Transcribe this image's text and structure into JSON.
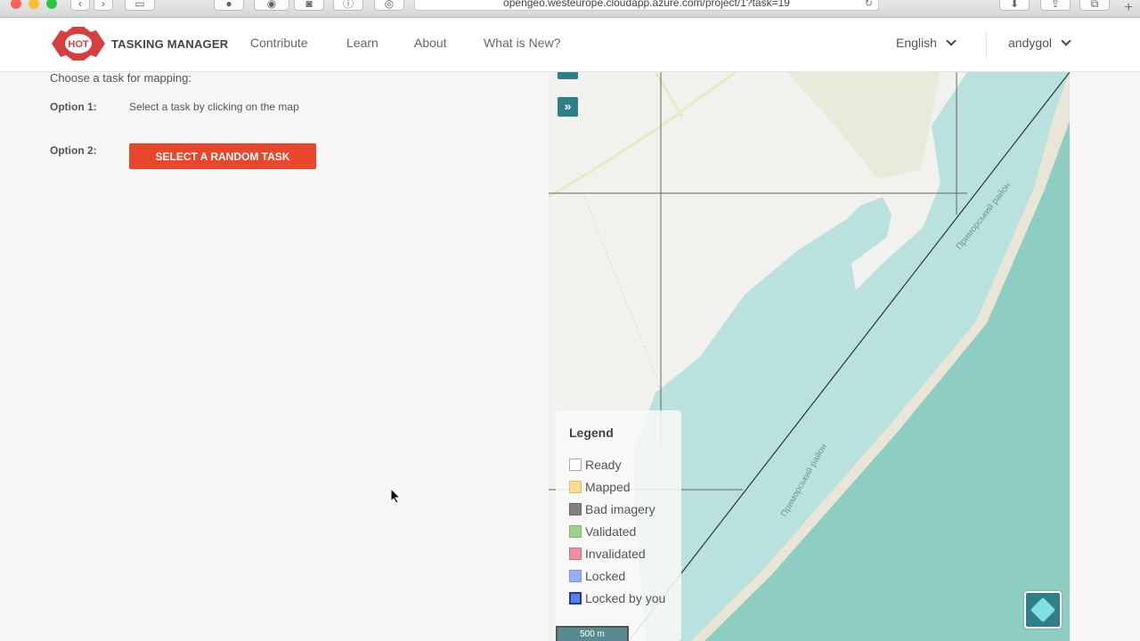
{
  "browser": {
    "url": "opengeo.westeurope.cloudapp.azure.com/project/1?task=19"
  },
  "header": {
    "logo_text": "HOT",
    "brand": "TASKING MANAGER",
    "nav": [
      {
        "label": "Contribute"
      },
      {
        "label": "Learn"
      },
      {
        "label": "About"
      },
      {
        "label": "What is New?"
      }
    ],
    "language": "English",
    "user": "andygol"
  },
  "panel": {
    "choose_text": "Choose a task for mapping:",
    "option1_label": "Option 1:",
    "option1_text": "Select a task by clicking on the map",
    "option2_label": "Option 2:",
    "random_button": "SELECT A RANDOM TASK"
  },
  "map": {
    "expand_icon": "»",
    "region_label_1": "Приморський район",
    "region_label_2": "Приморський район",
    "scale": "500 m",
    "legend": {
      "title": "Legend",
      "items": [
        {
          "label": "Ready",
          "color": "#ffffff"
        },
        {
          "label": "Mapped",
          "color": "#f9dc8f"
        },
        {
          "label": "Bad imagery",
          "color": "#808080"
        },
        {
          "label": "Validated",
          "color": "#9ed28a"
        },
        {
          "label": "Invalidated",
          "color": "#ef8fa0"
        },
        {
          "label": "Locked",
          "color": "#99aff5"
        },
        {
          "label": "Locked by you",
          "color": "#5b7ee8"
        }
      ]
    }
  },
  "colors": {
    "accent": "#e8472b",
    "map_control": "#2f7f8a",
    "sea": "#8ecdc2",
    "lagoon": "#b9e1de"
  }
}
